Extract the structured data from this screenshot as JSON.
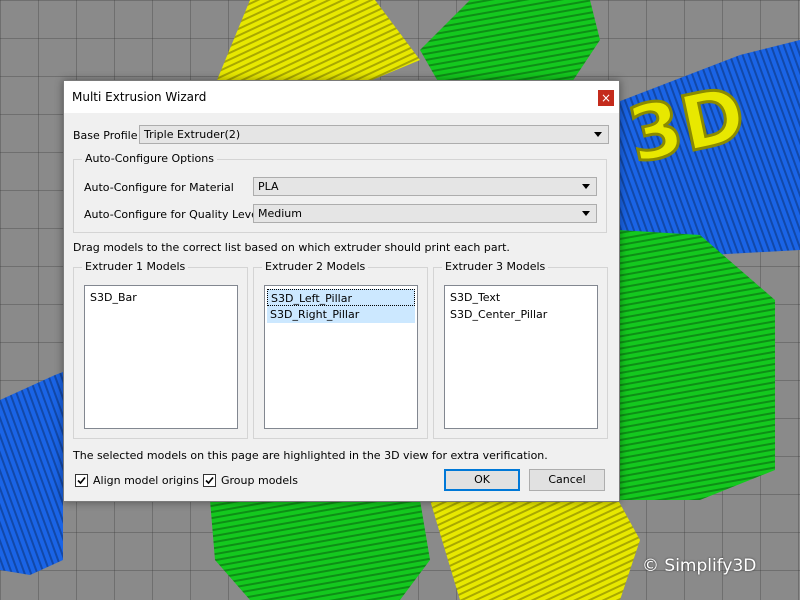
{
  "dialog": {
    "title": "Multi Extrusion Wizard",
    "close_glyph": "×",
    "base_profile": {
      "label": "Base Profile",
      "value": "Triple Extruder(2)"
    },
    "auto_configure": {
      "group_title": "Auto-Configure Options",
      "material": {
        "label": "Auto-Configure for Material",
        "value": "PLA"
      },
      "quality": {
        "label": "Auto-Configure for Quality Level",
        "value": "Medium"
      }
    },
    "instruction": "Drag models to the correct list based on which extruder should print each part.",
    "extruders": [
      {
        "title": "Extruder 1 Models",
        "items": [
          "S3D_Bar"
        ]
      },
      {
        "title": "Extruder 2 Models",
        "items": [
          "S3D_Left_Pillar",
          "S3D_Right_Pillar"
        ],
        "selected": [
          0,
          1
        ]
      },
      {
        "title": "Extruder 3 Models",
        "items": [
          "S3D_Text",
          "S3D_Center_Pillar"
        ]
      }
    ],
    "note": "The selected models on this page are highlighted in the 3D view for extra verification.",
    "options": {
      "align": {
        "label": "Align model origins",
        "checked": true
      },
      "group": {
        "label": "Group models",
        "checked": true
      }
    },
    "buttons": {
      "ok": "OK",
      "cancel": "Cancel"
    }
  },
  "scene": {
    "logo_text": "3D",
    "colors": {
      "yellow": "#e8e800",
      "green": "#14c81e",
      "blue": "#1a64e6",
      "grid": "#8a8a8a"
    }
  },
  "watermark": "© Simplify3D"
}
